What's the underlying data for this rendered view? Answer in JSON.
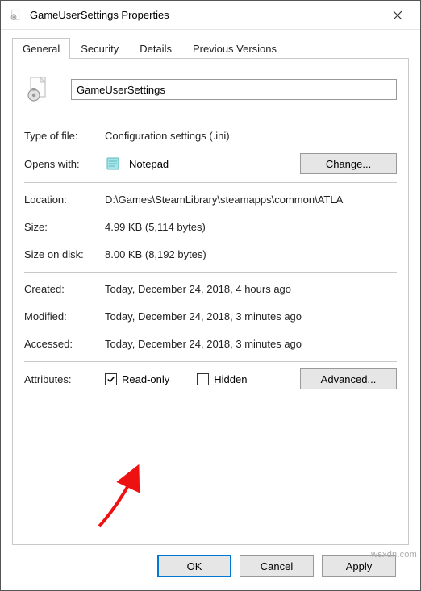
{
  "window": {
    "title": "GameUserSettings Properties"
  },
  "tabs": {
    "general": "General",
    "security": "Security",
    "details": "Details",
    "previous": "Previous Versions"
  },
  "filename": "GameUserSettings",
  "labels": {
    "type_of_file": "Type of file:",
    "opens_with": "Opens with:",
    "location": "Location:",
    "size": "Size:",
    "size_on_disk": "Size on disk:",
    "created": "Created:",
    "modified": "Modified:",
    "accessed": "Accessed:",
    "attributes": "Attributes:"
  },
  "values": {
    "type_of_file": "Configuration settings (.ini)",
    "opens_with_app": "Notepad",
    "location": "D:\\Games\\SteamLibrary\\steamapps\\common\\ATLA",
    "size": "4.99 KB (5,114 bytes)",
    "size_on_disk": "8.00 KB (8,192 bytes)",
    "created": "Today, December 24, 2018, 4 hours ago",
    "modified": "Today, December 24, 2018, 3 minutes ago",
    "accessed": "Today, December 24, 2018, 3 minutes ago"
  },
  "buttons": {
    "change": "Change...",
    "advanced": "Advanced...",
    "ok": "OK",
    "cancel": "Cancel",
    "apply": "Apply"
  },
  "attributes": {
    "read_only": "Read-only",
    "hidden": "Hidden"
  },
  "watermark": "wsxdn.com"
}
